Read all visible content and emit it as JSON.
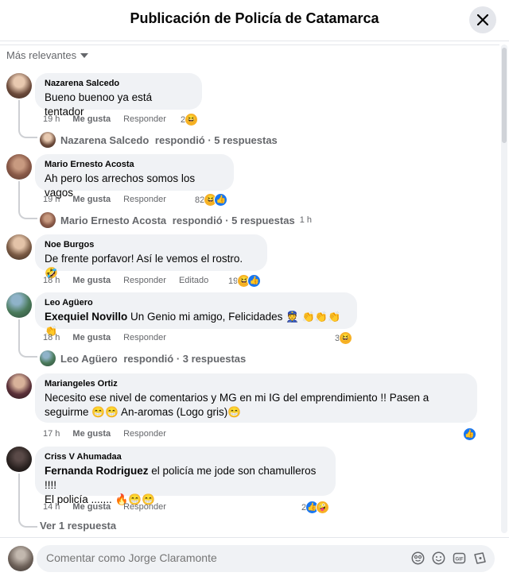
{
  "header": {
    "title": "Publicación de Policía de Catamarca"
  },
  "sort": {
    "label": "Más relevantes"
  },
  "labels": {
    "like": "Me gusta",
    "reply": "Responder",
    "edited": "Editado"
  },
  "comments": [
    {
      "author": "Nazarena Salcedo",
      "text": "Bueno buenoo ya está tentador",
      "time": "19 h",
      "reactions_count": "2",
      "replies": {
        "name": "Nazarena Salcedo",
        "text": "respondió · 5 respuestas",
        "time": ""
      }
    },
    {
      "author": "Mario Ernesto Acosta",
      "text": "Ah pero los arrechos somos los vagos",
      "time": "19 h",
      "reactions_count": "82",
      "replies": {
        "name": "Mario Ernesto Acosta",
        "text": "respondió · 5 respuestas",
        "time": "1 h"
      }
    },
    {
      "author": "Noe Burgos",
      "text": "De frente porfavor! Así le vemos el rostro.",
      "time": "18 h",
      "reactions_count": "19",
      "edited": true
    },
    {
      "author": "Leo Agüero",
      "mention": "Exequiel Novillo",
      "text": "Un Genio mi amigo, Felicidades",
      "time": "18 h",
      "reactions_count": "3",
      "replies": {
        "name": "Leo Agüero",
        "text": "respondió · 3 respuestas",
        "time": ""
      }
    },
    {
      "author": "Mariangeles Ortiz",
      "text_line1": "Necesito ese nivel de comentarios y MG en mi IG del emprendimiento !! Pasen a",
      "text_line2a": "seguirme",
      "text_line2b": "An-aromas (Logo gris)",
      "time": "17 h",
      "reactions_count": ""
    },
    {
      "author": "Criss V Ahumadaa",
      "mention": "Fernanda Rodriguez",
      "text_line1": "el policía me jode son chamulleros !!!!",
      "text_line2": "El policía .......",
      "time": "14 h",
      "reactions_count": "2",
      "view_replies": "Ver 1 respuesta"
    }
  ],
  "composer": {
    "placeholder": "Comentar como Jorge Claramonte"
  },
  "colors": {
    "like_blue": "#1877f2",
    "haha_yellow": "#f7b125",
    "bubble_bg": "#f0f2f5",
    "meta_gray": "#65676b"
  },
  "icons": [
    "close-icon",
    "caret-down-icon",
    "haha-reaction-icon",
    "like-reaction-icon",
    "care-reaction-icon",
    "sticker-icon",
    "emoji-icon",
    "gif-icon",
    "camera-icon"
  ]
}
